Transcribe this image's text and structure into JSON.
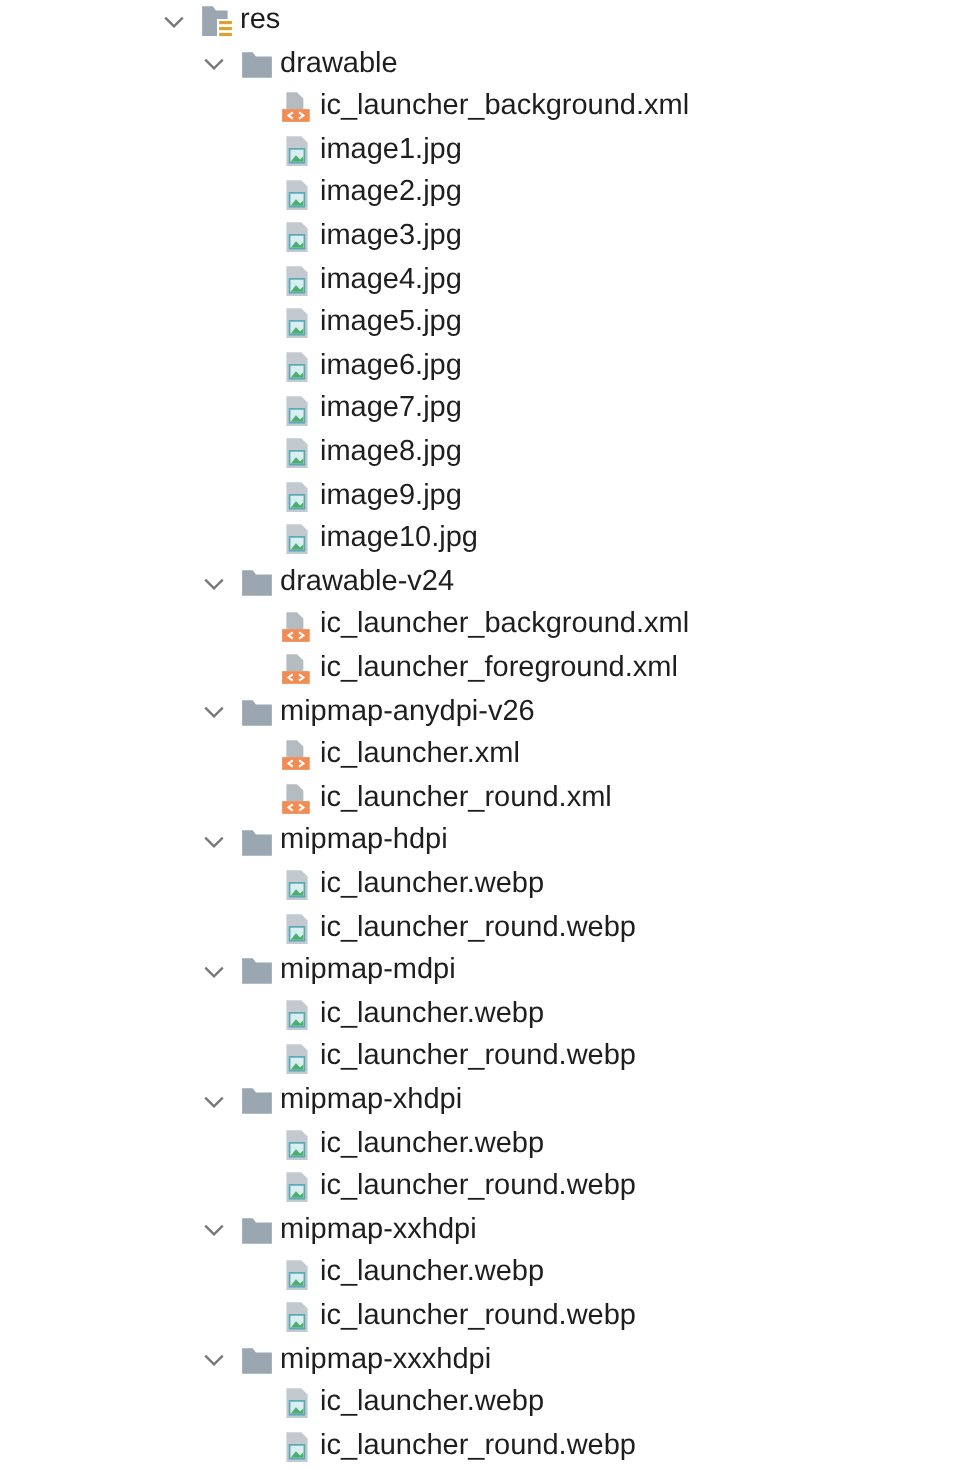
{
  "tree": [
    {
      "label": "res",
      "kind": "resources",
      "expanded": true,
      "children": [
        {
          "label": "drawable",
          "kind": "folder",
          "expanded": true,
          "children": [
            {
              "label": "ic_launcher_background.xml",
              "kind": "xml"
            },
            {
              "label": "image1.jpg",
              "kind": "image"
            },
            {
              "label": "image2.jpg",
              "kind": "image"
            },
            {
              "label": "image3.jpg",
              "kind": "image"
            },
            {
              "label": "image4.jpg",
              "kind": "image"
            },
            {
              "label": "image5.jpg",
              "kind": "image"
            },
            {
              "label": "image6.jpg",
              "kind": "image"
            },
            {
              "label": "image7.jpg",
              "kind": "image"
            },
            {
              "label": "image8.jpg",
              "kind": "image"
            },
            {
              "label": "image9.jpg",
              "kind": "image"
            },
            {
              "label": "image10.jpg",
              "kind": "image"
            }
          ]
        },
        {
          "label": "drawable-v24",
          "kind": "folder",
          "expanded": true,
          "children": [
            {
              "label": "ic_launcher_background.xml",
              "kind": "xml"
            },
            {
              "label": "ic_launcher_foreground.xml",
              "kind": "xml"
            }
          ]
        },
        {
          "label": "mipmap-anydpi-v26",
          "kind": "folder",
          "expanded": true,
          "children": [
            {
              "label": "ic_launcher.xml",
              "kind": "xml"
            },
            {
              "label": "ic_launcher_round.xml",
              "kind": "xml"
            }
          ]
        },
        {
          "label": "mipmap-hdpi",
          "kind": "folder",
          "expanded": true,
          "children": [
            {
              "label": "ic_launcher.webp",
              "kind": "image"
            },
            {
              "label": "ic_launcher_round.webp",
              "kind": "image"
            }
          ]
        },
        {
          "label": "mipmap-mdpi",
          "kind": "folder",
          "expanded": true,
          "children": [
            {
              "label": "ic_launcher.webp",
              "kind": "image"
            },
            {
              "label": "ic_launcher_round.webp",
              "kind": "image"
            }
          ]
        },
        {
          "label": "mipmap-xhdpi",
          "kind": "folder",
          "expanded": true,
          "children": [
            {
              "label": "ic_launcher.webp",
              "kind": "image"
            },
            {
              "label": "ic_launcher_round.webp",
              "kind": "image"
            }
          ]
        },
        {
          "label": "mipmap-xxhdpi",
          "kind": "folder",
          "expanded": true,
          "children": [
            {
              "label": "ic_launcher.webp",
              "kind": "image"
            },
            {
              "label": "ic_launcher_round.webp",
              "kind": "image"
            }
          ]
        },
        {
          "label": "mipmap-xxxhdpi",
          "kind": "folder",
          "expanded": true,
          "children": [
            {
              "label": "ic_launcher.webp",
              "kind": "image"
            },
            {
              "label": "ic_launcher_round.webp",
              "kind": "image"
            }
          ]
        }
      ]
    }
  ]
}
